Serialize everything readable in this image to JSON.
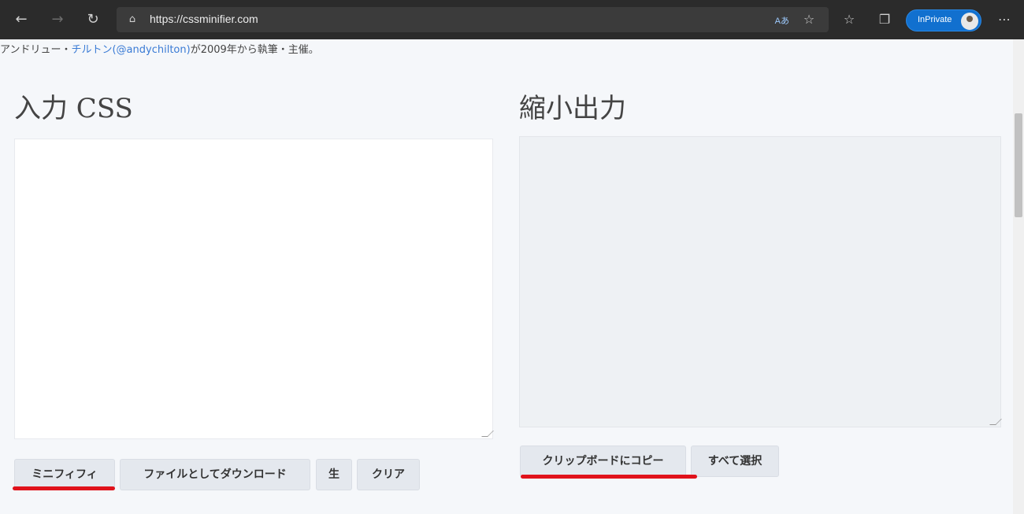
{
  "browser": {
    "url": "https://cssminifier.com",
    "reader_mode_label": "Aあ",
    "inprivate_label": "InPrivate",
    "icons": {
      "back": "back-arrow-icon",
      "forward": "forward-arrow-icon",
      "refresh": "refresh-icon",
      "lock": "lock-icon",
      "favorite": "favorite-star-icon",
      "favorites_bar": "favorites-icon",
      "collections": "collections-icon",
      "more": "more-icon"
    }
  },
  "credit": {
    "prefix": "アンドリュー・",
    "author_link": "チルトン(@andychilton)",
    "suffix": "が2009年から執筆・主催。"
  },
  "input_panel": {
    "title": "入力 CSS",
    "buttons": {
      "minify": "ミニフィフィ",
      "download": "ファイルとしてダウンロード",
      "raw": "生",
      "clear": "クリア"
    }
  },
  "output_panel": {
    "title": "縮小出力",
    "buttons": {
      "copy": "クリップボードにコピー",
      "select_all": "すべて選択"
    }
  },
  "highlight_color": "#e0121b"
}
